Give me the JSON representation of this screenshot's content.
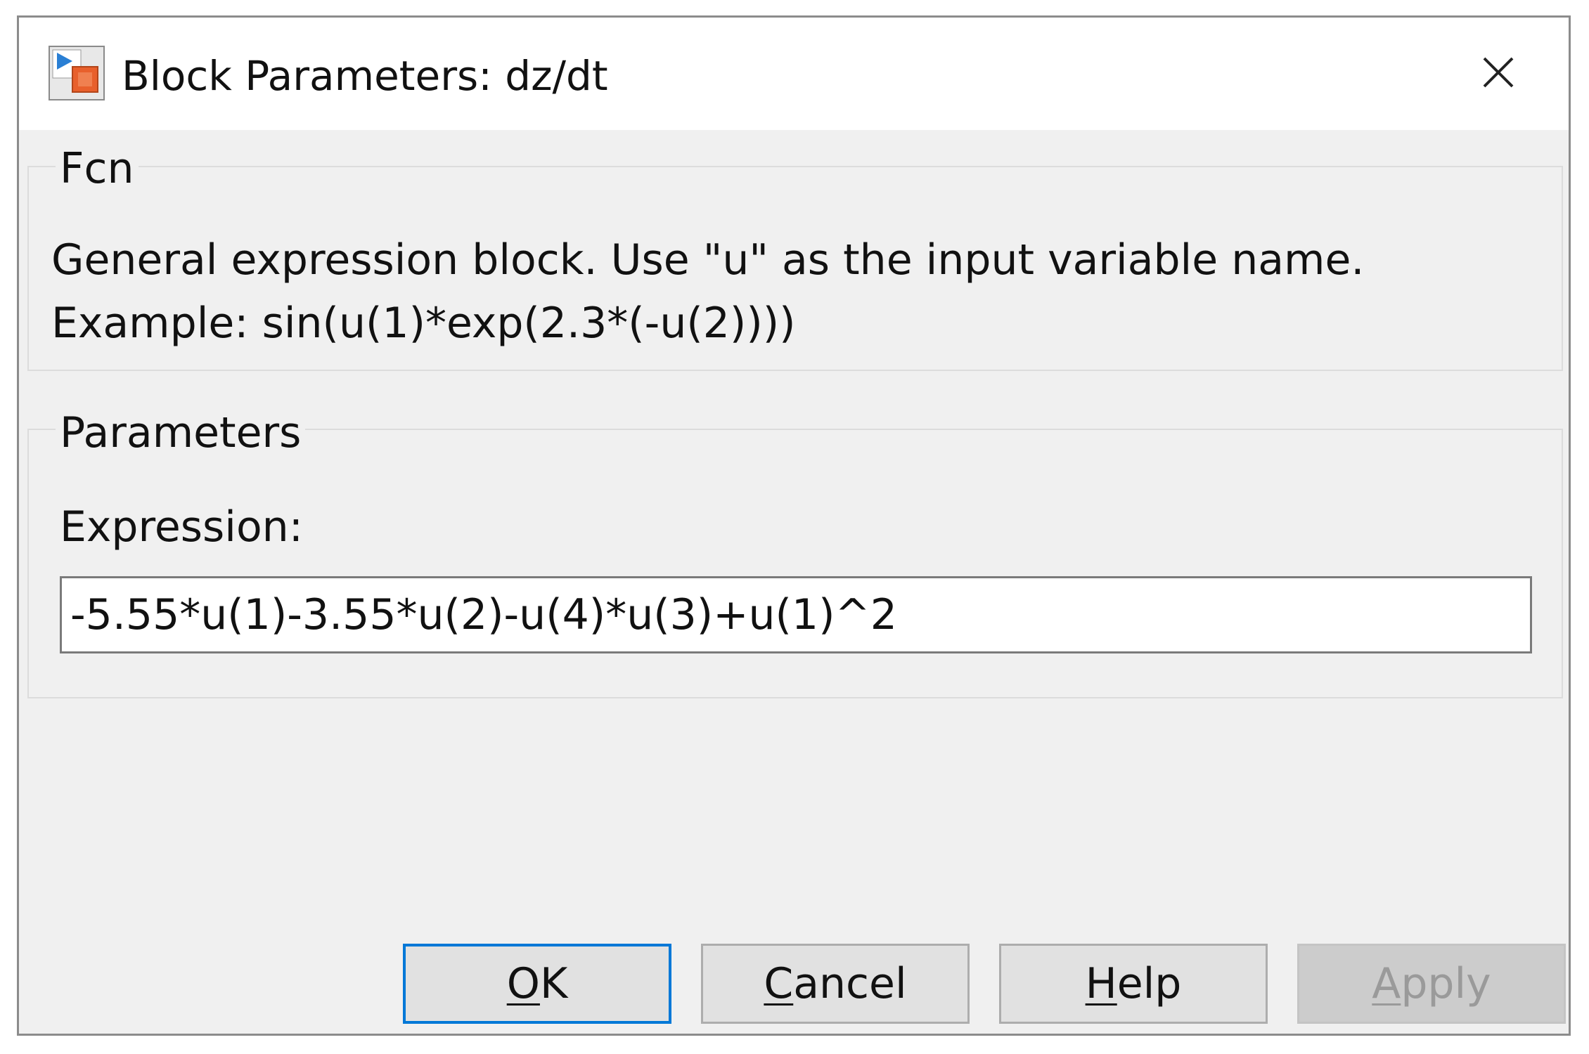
{
  "window": {
    "title": "Block Parameters: dz/dt",
    "app_icon": "simulink-block-icon",
    "close_icon": "close-icon"
  },
  "fcn_group": {
    "legend": "Fcn",
    "description_line1": "General expression block. Use \"u\" as the input variable name.",
    "description_line2": "Example: sin(u(1)*exp(2.3*(-u(2))))"
  },
  "parameters_group": {
    "legend": "Parameters",
    "expression_label": "Expression:",
    "expression_value": "-5.55*u(1)-3.55*u(2)-u(4)*u(3)+u(1)^2"
  },
  "buttons": {
    "ok": {
      "first": "O",
      "rest": "K"
    },
    "cancel": {
      "first": "C",
      "rest": "ancel"
    },
    "help": {
      "first": "H",
      "rest": "elp"
    },
    "apply": {
      "first": "A",
      "rest": "pply"
    }
  },
  "colors": {
    "dialog_bg": "#f0f0f0",
    "titlebar_bg": "#ffffff",
    "focus_border": "#0078d7",
    "disabled_text": "#9a9a9a"
  }
}
